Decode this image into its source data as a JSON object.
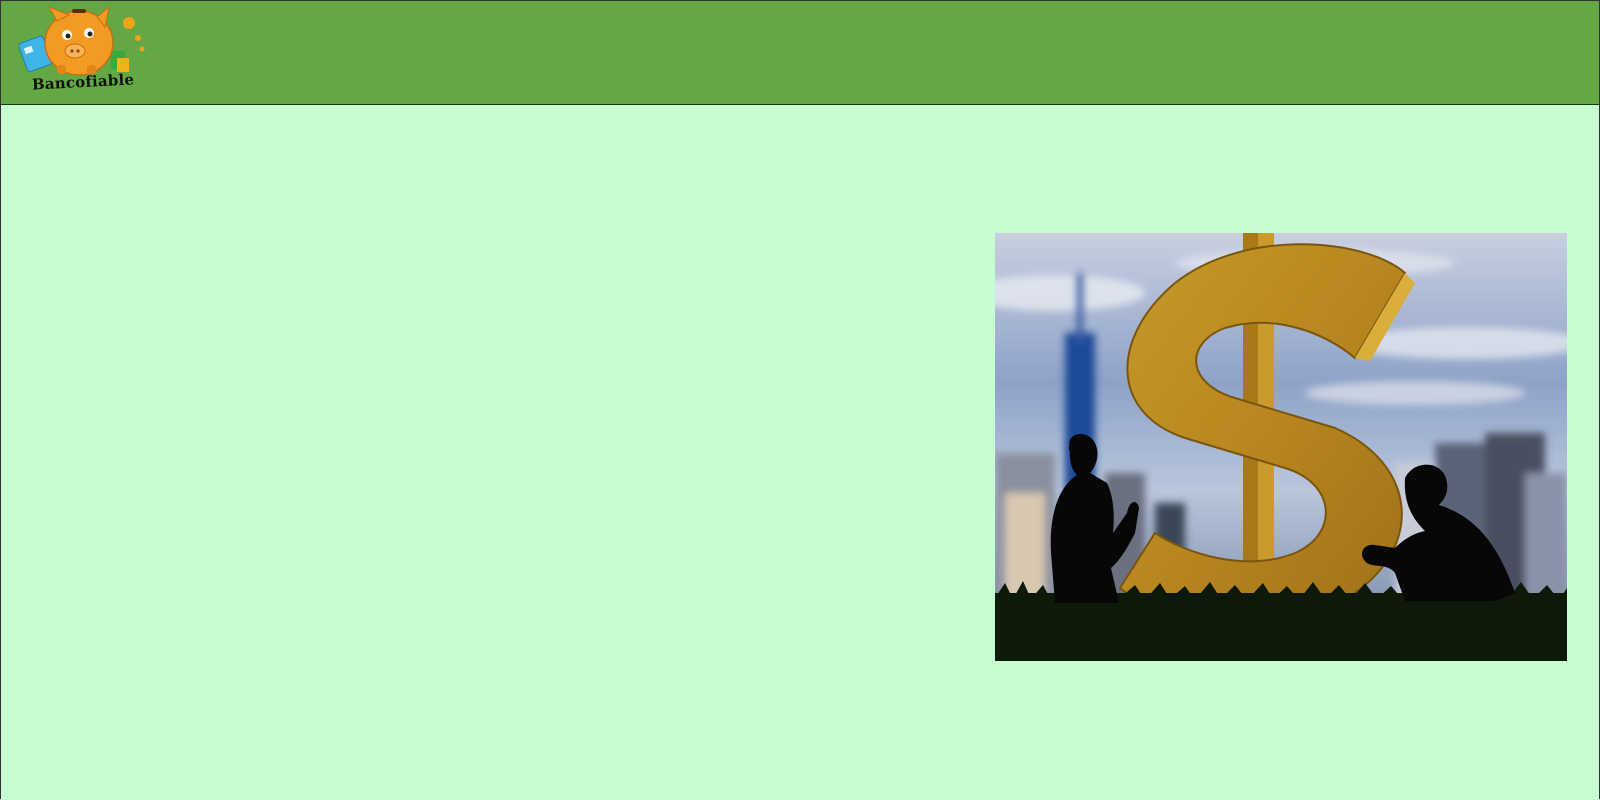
{
  "brand": {
    "name": "Bancofiable",
    "logo_icon": "piggy-bank-icon"
  },
  "colors": {
    "header": "#63a845",
    "page_background": "#c8fcd2"
  },
  "hero_image": {
    "subject": "dollar-sign-with-kneeling-silhouettes"
  }
}
